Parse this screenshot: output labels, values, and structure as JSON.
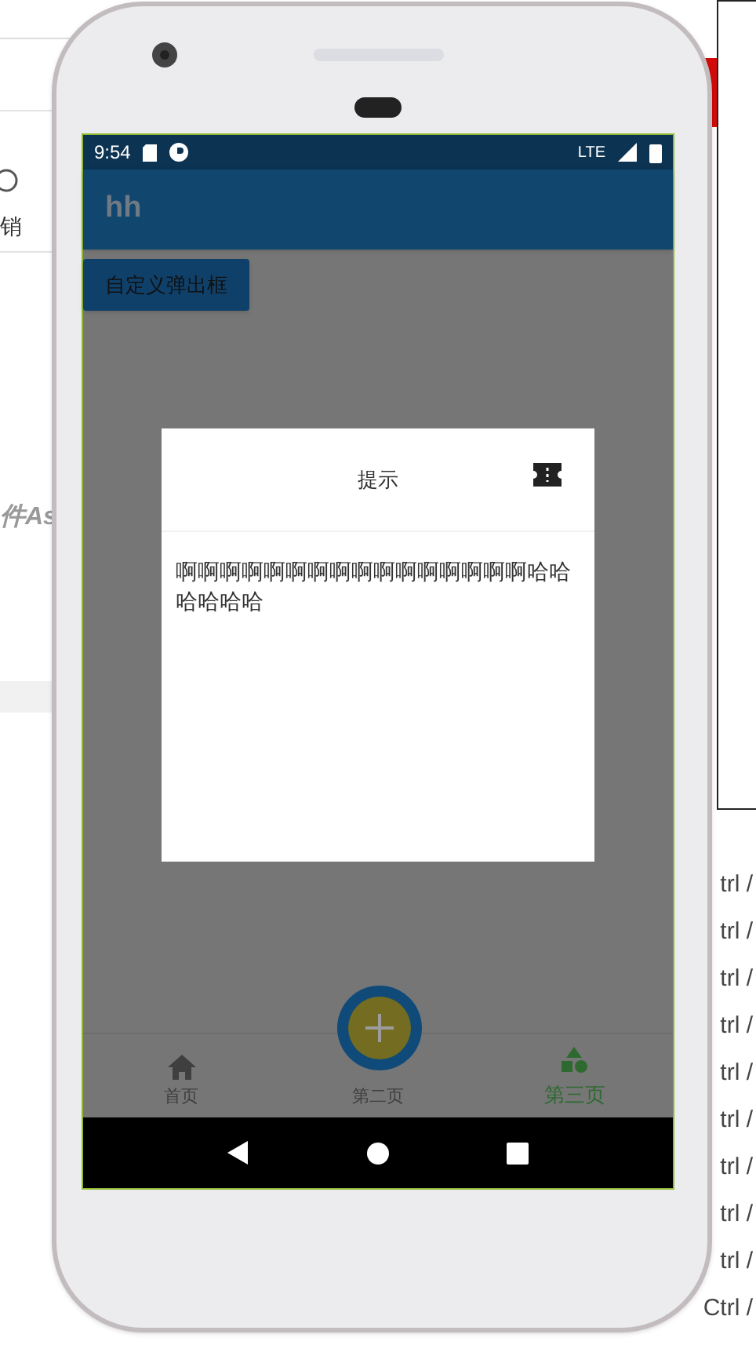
{
  "background": {
    "undo_label": "销",
    "italic_text": "件As",
    "shortcuts": [
      "trl /",
      "trl /",
      "trl /",
      "trl /",
      "trl /",
      "trl /",
      "trl /",
      "trl /",
      "trl /",
      "Ctrl /"
    ]
  },
  "status_bar": {
    "time": "9:54",
    "network": "LTE"
  },
  "app_bar": {
    "title": "hh"
  },
  "custom_dialog_button": {
    "label": "自定义弹出框"
  },
  "dialog": {
    "title": "提示",
    "message": "啊啊啊啊啊啊啊啊啊啊啊啊啊啊啊啊哈哈哈哈哈哈"
  },
  "bottom_nav": [
    {
      "label": "首页",
      "kind": "home",
      "selected": false
    },
    {
      "label": "第二页",
      "kind": "add",
      "selected": false
    },
    {
      "label": "第三页",
      "kind": "shapes",
      "selected": true
    }
  ]
}
